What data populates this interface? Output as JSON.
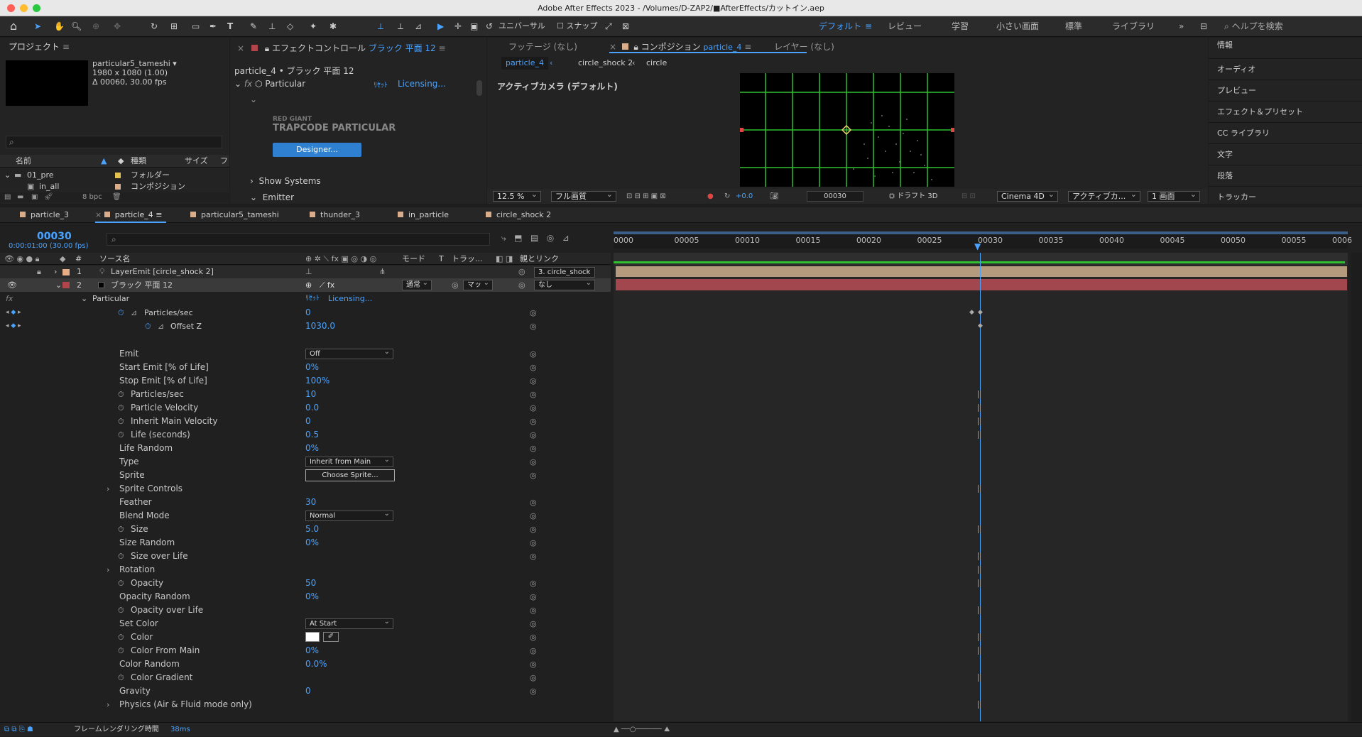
{
  "window_title": "Adobe After Effects 2023 - /Volumes/D-ZAP2/■AfterEffects/カットイン.aep",
  "toolbar": {
    "universal": "ユニバーサル",
    "snap": "スナップ",
    "workspaces": [
      "デフォルト",
      "レビュー",
      "学習",
      "小さい画面",
      "標準",
      "ライブラリ"
    ],
    "search_placeholder": "ヘルプを検索"
  },
  "project": {
    "title": "プロジェクト",
    "item_name": "particular5_tameshi ▾",
    "item_info1": "1980 x 1080 (1.00)",
    "item_info2": "Δ 00060, 30.00 fps",
    "col_name": "名前",
    "col_type": "種類",
    "col_size": "サイズ",
    "col_f": "フ",
    "items": [
      {
        "name": "01_pre",
        "type": "フォルダー"
      },
      {
        "name": "in_all",
        "type": "コンポジション"
      }
    ],
    "bpc": "8 bpc"
  },
  "effects": {
    "title": "エフェクトコントロール",
    "title_layer": "ブラック 平面 12",
    "sub": "particle_4 • ブラック 平面 12",
    "fx_name": "Particular",
    "reset": "ﾘｾｯﾄ",
    "licensing": "Licensing...",
    "brand1": "RED GIANT",
    "brand2": "TRAPCODE PARTICULAR",
    "designer": "Designer...",
    "show_systems": "Show Systems",
    "emitter": "Emitter"
  },
  "footage": {
    "tab": "フッテージ (なし)"
  },
  "comp": {
    "tab": "コンポジション",
    "tab_name": "particle_4",
    "layer_tab": "レイヤー (なし)",
    "crumbs": [
      "particle_4",
      "circle_shock 2",
      "circle"
    ],
    "camera": "アクティブカメラ (デフォルト)",
    "zoom": "12.5 %",
    "quality": "フル画質",
    "exposure": "+0.0",
    "time": "00030",
    "draft": "ドラフト 3D",
    "renderer": "Cinema 4D",
    "view": "アクティブカ...",
    "views": "1 画面"
  },
  "right_panels": [
    "情報",
    "オーディオ",
    "プレビュー",
    "エフェクト＆プリセット",
    "CC ライブラリ",
    "文字",
    "段落",
    "トラッカー"
  ],
  "timeline": {
    "tabs": [
      "particle_3",
      "particle_4",
      "particular5_tameshi",
      "thunder_3",
      "in_particle",
      "circle_shock 2"
    ],
    "time": "00030",
    "time_sub": "0:00:01:00 (30.00 fps)",
    "col_source": "ソース名",
    "col_mode": "モード",
    "col_t": "T",
    "col_track": "トラッ...",
    "col_parent": "親とリンク",
    "ruler": [
      "0000",
      "00005",
      "00010",
      "00015",
      "00020",
      "00025",
      "00030",
      "00035",
      "00040",
      "00045",
      "00050",
      "00055",
      "0006"
    ],
    "layers": [
      {
        "num": "1",
        "name": "LayerEmit [circle_shock 2]",
        "parent": "3. circle_shock"
      },
      {
        "num": "2",
        "name": "ブラック 平面 12",
        "mode": "通常",
        "track": "マッ",
        "parent": "なし"
      }
    ],
    "effect_name": "Particular",
    "reset": "ﾘｾｯﾄ",
    "licensing": "Licensing...",
    "kf_props": [
      {
        "name": "Particles/sec",
        "value": "0"
      },
      {
        "name": "Offset Z",
        "value": "1030.0"
      }
    ],
    "props": [
      {
        "name": "Emit",
        "dd": "Off"
      },
      {
        "name": "Start Emit [% of Life]",
        "value": "0%"
      },
      {
        "name": "Stop Emit [% of Life]",
        "value": "100%"
      },
      {
        "name": "Particles/sec",
        "value": "10",
        "sw": true
      },
      {
        "name": "Particle Velocity",
        "value": "0.0",
        "sw": true
      },
      {
        "name": "Inherit Main Velocity",
        "value": "0",
        "sw": true
      },
      {
        "name": "Life (seconds)",
        "value": "0.5",
        "sw": true
      },
      {
        "name": "Life Random",
        "value": "0%"
      },
      {
        "name": "Type",
        "dd": "Inherit from Main"
      },
      {
        "name": "Sprite",
        "btn": "Choose Sprite..."
      },
      {
        "name": "Sprite Controls",
        "group": true
      },
      {
        "name": "Feather",
        "value": "30"
      },
      {
        "name": "Blend Mode",
        "dd": "Normal"
      },
      {
        "name": "Size",
        "value": "5.0",
        "sw": true
      },
      {
        "name": "Size Random",
        "value": "0%"
      },
      {
        "name": "Size over Life",
        "sw": true
      },
      {
        "name": "Rotation",
        "group": true
      },
      {
        "name": "Opacity",
        "value": "50",
        "sw": true
      },
      {
        "name": "Opacity Random",
        "value": "0%"
      },
      {
        "name": "Opacity over Life",
        "sw": true
      },
      {
        "name": "Set Color",
        "dd": "At Start"
      },
      {
        "name": "Color",
        "sw": true,
        "color": true
      },
      {
        "name": "Color From Main",
        "value": "0%",
        "sw": true
      },
      {
        "name": "Color Random",
        "value": "0.0%"
      },
      {
        "name": "Color Gradient",
        "sw": true
      },
      {
        "name": "Gravity",
        "value": "0"
      },
      {
        "name": "Physics (Air & Fluid mode only)",
        "group": true
      }
    ],
    "status": "フレームレンダリング時間",
    "status_val": "38ms"
  },
  "colors": {
    "accent": "#4aa3ff",
    "layer1": "#b59a7e",
    "layer2": "#a1474d",
    "grid": "#2fbf2f",
    "playhead": "#4aa3ff"
  }
}
